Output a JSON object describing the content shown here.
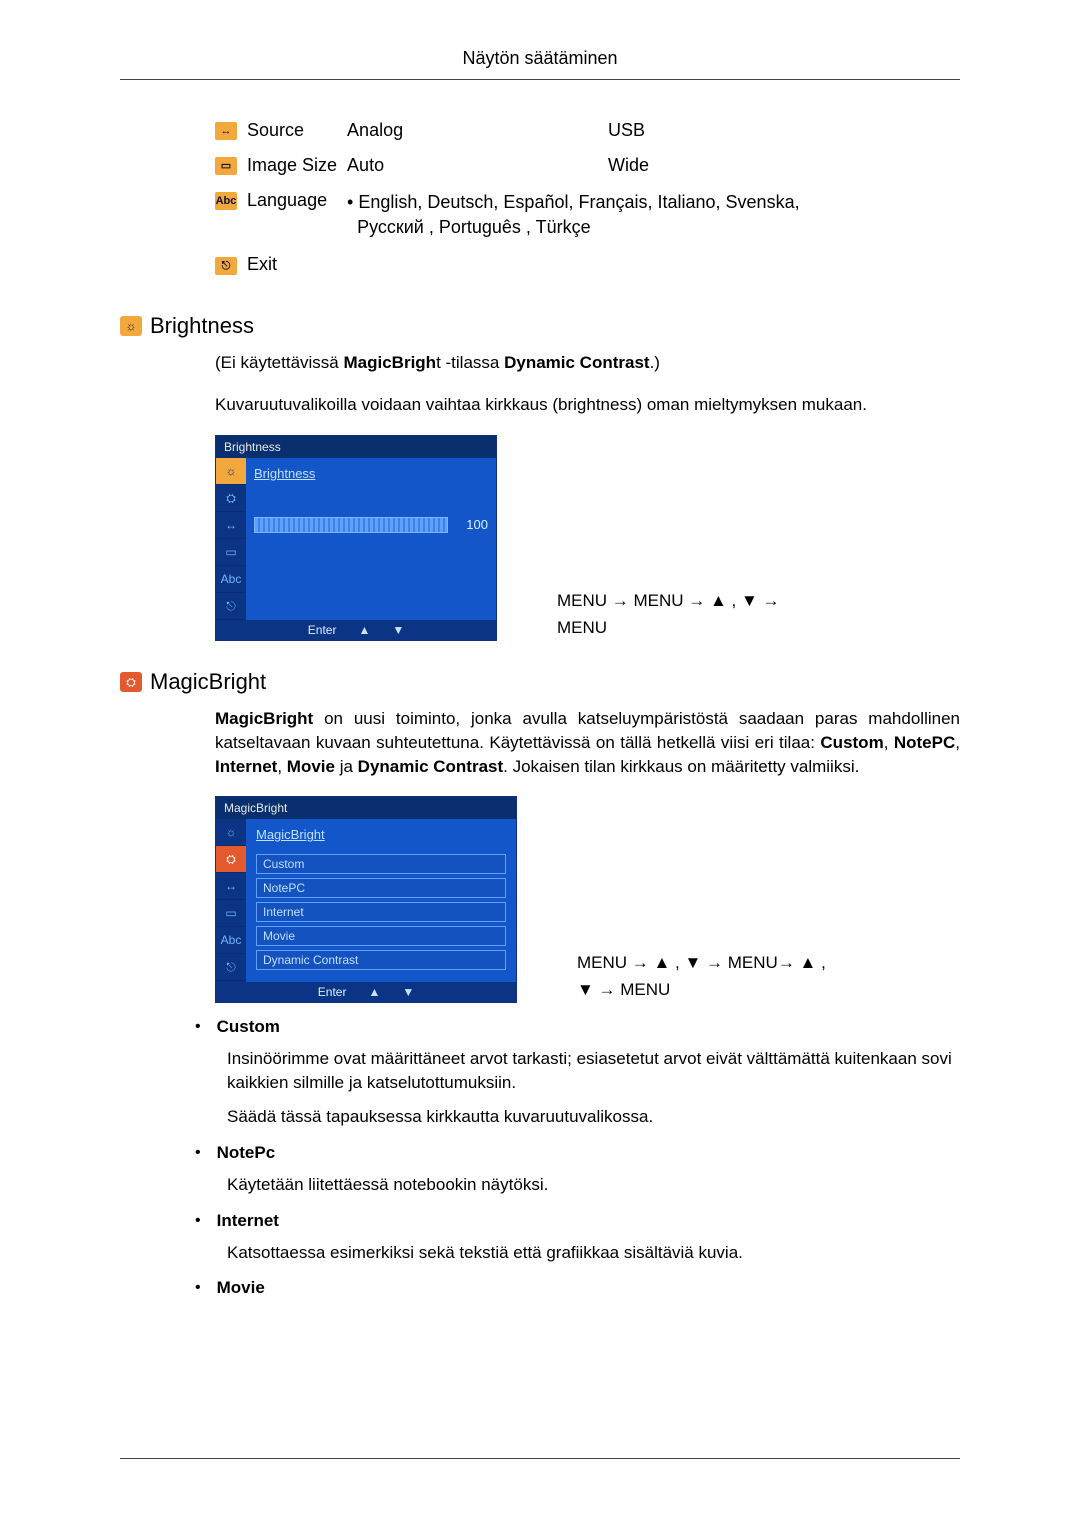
{
  "header": {
    "title": "Näytön säätäminen"
  },
  "menu": {
    "rows": [
      {
        "icon": "↔",
        "label": "Source",
        "col1": "Analog",
        "col2": "USB"
      },
      {
        "icon": "▭",
        "label": "Image Size",
        "col1": "Auto",
        "col2": "Wide"
      },
      {
        "icon": "Abc",
        "label": "Language",
        "col1": "",
        "col2": ""
      },
      {
        "icon": "⎋",
        "label": "Exit",
        "col1": "",
        "col2": ""
      }
    ],
    "language_note_line1": "• English, Deutsch, Español, Français,  Italiano, Svenska,",
    "language_note_line2": "Русский , Português , Türkçe"
  },
  "brightness": {
    "section_title": "Brightness",
    "note_prefix": "(Ei käytettävissä ",
    "note_b1": "MagicBrigh",
    "note_mid": "t -tilassa ",
    "note_b2": "Dynamic Contrast",
    "note_suffix": ".)",
    "desc": "Kuvaruutuvalikoilla voidaan vaihtaa kirkkaus (brightness) oman mieltymyksen mukaan.",
    "osd": {
      "title": "Brightness",
      "heading": "Brightness",
      "value": "100",
      "side_icons": [
        "☼",
        "⛭",
        "↔",
        "▭",
        "Abc",
        "⎋"
      ],
      "footer_enter": "Enter",
      "footer_up": "▲",
      "footer_down": "▼"
    },
    "nav_line1": "MENU → MENU → ▲ , ▼ →",
    "nav_line2": "MENU"
  },
  "magicbright": {
    "section_title": "MagicBright",
    "intro_b1": "MagicBright",
    "intro_part1": " on uusi toiminto, jonka avulla katseluympäristöstä saadaan paras mahdollinen katseltavaan kuvaan suhteutettuna. Käytettävissä on tällä hetkellä viisi eri tilaa: ",
    "intro_b2": "Custom",
    "intro_sep1": ", ",
    "intro_b3": "NotePC",
    "intro_sep2": ", ",
    "intro_b4": "Internet",
    "intro_sep3": ", ",
    "intro_b5": "Movie",
    "intro_sep4": " ja ",
    "intro_b6": "Dynamic Contrast",
    "intro_part2": ". Jokaisen tilan kirkkaus on määritetty valmiiksi.",
    "osd": {
      "title": "MagicBright",
      "heading": "MagicBright",
      "options": [
        "Custom",
        "NotePC",
        "Internet",
        "Movie",
        "Dynamic Contrast"
      ],
      "side_icons": [
        "☼",
        "⛭",
        "↔",
        "▭",
        "Abc",
        "⎋"
      ],
      "footer_enter": "Enter",
      "footer_up": "▲",
      "footer_down": "▼"
    },
    "nav_line1": "MENU → ▲ , ▼ → MENU→ ▲ ,",
    "nav_line2": "▼ → MENU",
    "bullets": [
      {
        "title": "Custom",
        "body1": "Insinöörimme ovat määrittäneet arvot tarkasti; esiasetetut arvot eivät välttämättä kuitenkaan sovi kaikkien silmille ja katselutottumuksiin.",
        "body2": "Säädä tässä tapauksessa kirkkautta kuvaruutuvalikossa."
      },
      {
        "title": "NotePc",
        "body1": "Käytetään liitettäessä notebookin näytöksi.",
        "body2": ""
      },
      {
        "title": "Internet",
        "body1": "Katsottaessa esimerkiksi sekä tekstiä että grafiikkaa sisältäviä kuvia.",
        "body2": ""
      },
      {
        "title": "Movie",
        "body1": "",
        "body2": ""
      }
    ]
  },
  "chart_data": {
    "type": "table",
    "title": "OSD menu options",
    "rows": [
      {
        "item": "Source",
        "values": [
          "Analog",
          "USB"
        ]
      },
      {
        "item": "Image Size",
        "values": [
          "Auto",
          "Wide"
        ]
      },
      {
        "item": "Language",
        "values": [
          "English",
          "Deutsch",
          "Español",
          "Français",
          "Italiano",
          "Svenska",
          "Русский",
          "Português",
          "Türkçe"
        ]
      },
      {
        "item": "Exit",
        "values": []
      }
    ],
    "brightness_value": 100,
    "brightness_range": [
      0,
      100
    ],
    "magicbright_modes": [
      "Custom",
      "NotePC",
      "Internet",
      "Movie",
      "Dynamic Contrast"
    ]
  }
}
